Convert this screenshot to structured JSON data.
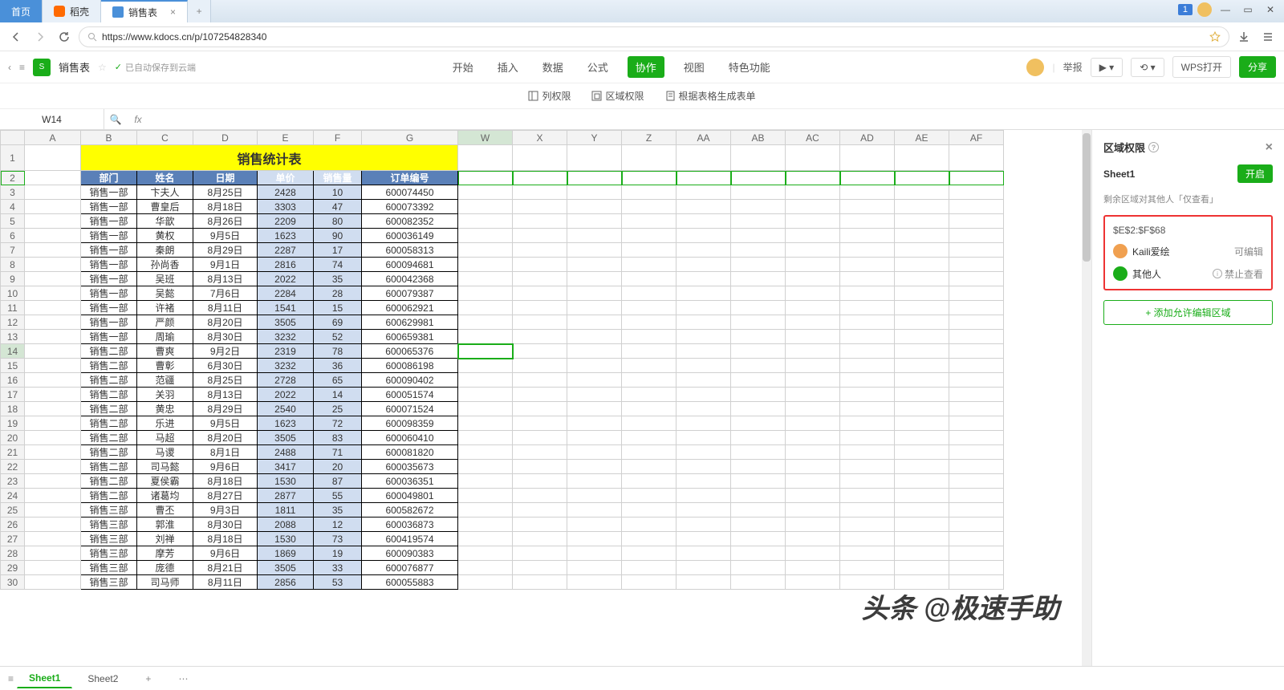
{
  "titlebar": {
    "home": "首页",
    "dk": "稻壳",
    "doc": "销售表",
    "badge": "1"
  },
  "addr": {
    "url": "https://www.kdocs.cn/p/107254828340"
  },
  "doc": {
    "back_icon": "chevron-left",
    "name": "销售表",
    "autosave": "已自动保存到云端"
  },
  "menu": {
    "items": [
      "开始",
      "插入",
      "数据",
      "公式",
      "协作",
      "视图",
      "特色功能"
    ],
    "active": 4
  },
  "docright": {
    "report": "举报",
    "wps": "WPS打开",
    "share": "分享"
  },
  "subtb": {
    "col": "列权限",
    "area": "区域权限",
    "form": "根据表格生成表单"
  },
  "fx": {
    "namebox": "W14"
  },
  "cols": [
    "A",
    "B",
    "C",
    "D",
    "E",
    "F",
    "G",
    "W",
    "X",
    "Y",
    "Z",
    "AA",
    "AB",
    "AC",
    "AD",
    "AE",
    "AF"
  ],
  "title": "销售统计表",
  "headers": [
    "部门",
    "姓名",
    "日期",
    "单价",
    "销售量",
    "订单编号"
  ],
  "rows": [
    [
      "销售一部",
      "卞夫人",
      "8月25日",
      "2428",
      "10",
      "600074450"
    ],
    [
      "销售一部",
      "曹皇后",
      "8月18日",
      "3303",
      "47",
      "600073392"
    ],
    [
      "销售一部",
      "华歆",
      "8月26日",
      "2209",
      "80",
      "600082352"
    ],
    [
      "销售一部",
      "黄权",
      "9月5日",
      "1623",
      "90",
      "600036149"
    ],
    [
      "销售一部",
      "秦朗",
      "8月29日",
      "2287",
      "17",
      "600058313"
    ],
    [
      "销售一部",
      "孙尚香",
      "9月1日",
      "2816",
      "74",
      "600094681"
    ],
    [
      "销售一部",
      "吴班",
      "8月13日",
      "2022",
      "35",
      "600042368"
    ],
    [
      "销售一部",
      "吴懿",
      "7月6日",
      "2284",
      "28",
      "600079387"
    ],
    [
      "销售一部",
      "许褚",
      "8月11日",
      "1541",
      "15",
      "600062921"
    ],
    [
      "销售一部",
      "严颜",
      "8月20日",
      "3505",
      "69",
      "600629981"
    ],
    [
      "销售一部",
      "周瑜",
      "8月30日",
      "3232",
      "52",
      "600659381"
    ],
    [
      "销售二部",
      "曹爽",
      "9月2日",
      "2319",
      "78",
      "600065376"
    ],
    [
      "销售二部",
      "曹彰",
      "6月30日",
      "3232",
      "36",
      "600086198"
    ],
    [
      "销售二部",
      "范疆",
      "8月25日",
      "2728",
      "65",
      "600090402"
    ],
    [
      "销售二部",
      "关羽",
      "8月13日",
      "2022",
      "14",
      "600051574"
    ],
    [
      "销售二部",
      "黄忠",
      "8月29日",
      "2540",
      "25",
      "600071524"
    ],
    [
      "销售二部",
      "乐进",
      "9月5日",
      "1623",
      "72",
      "600098359"
    ],
    [
      "销售二部",
      "马超",
      "8月20日",
      "3505",
      "83",
      "600060410"
    ],
    [
      "销售二部",
      "马谡",
      "8月1日",
      "2488",
      "71",
      "600081820"
    ],
    [
      "销售二部",
      "司马懿",
      "9月6日",
      "3417",
      "20",
      "600035673"
    ],
    [
      "销售二部",
      "夏侯霸",
      "8月18日",
      "1530",
      "87",
      "600036351"
    ],
    [
      "销售二部",
      "诸葛均",
      "8月27日",
      "2877",
      "55",
      "600049801"
    ],
    [
      "销售三部",
      "曹丕",
      "9月3日",
      "1811",
      "35",
      "600582672"
    ],
    [
      "销售三部",
      "郭淮",
      "8月30日",
      "2088",
      "12",
      "600036873"
    ],
    [
      "销售三部",
      "刘禅",
      "8月18日",
      "1530",
      "73",
      "600419574"
    ],
    [
      "销售三部",
      "摩芳",
      "9月6日",
      "1869",
      "19",
      "600090383"
    ],
    [
      "销售三部",
      "庞德",
      "8月21日",
      "3505",
      "33",
      "600076877"
    ],
    [
      "销售三部",
      "司马师",
      "8月11日",
      "2856",
      "53",
      "600055883"
    ]
  ],
  "side": {
    "title": "区域权限",
    "sheet": "Sheet1",
    "open": "开启",
    "note": "剩余区域对其他人「仅查看」",
    "range": "$E$2:$F$68",
    "user1": "Kaili爱绘",
    "perm1": "可编辑",
    "user2": "其他人",
    "perm2": "禁止查看",
    "add": "+ 添加允许编辑区域"
  },
  "btabs": {
    "s1": "Sheet1",
    "s2": "Sheet2"
  },
  "watermark": "头条 @极速手助"
}
